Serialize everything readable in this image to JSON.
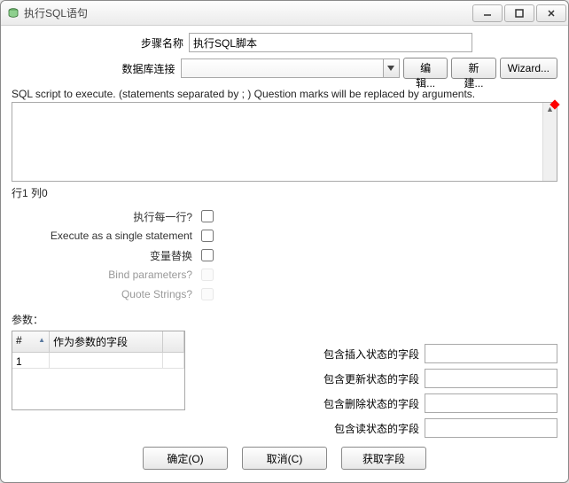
{
  "titlebar": {
    "title": "执行SQL语句"
  },
  "form": {
    "step_name_label": "步骤名称",
    "step_name_value": "执行SQL脚本",
    "db_conn_label": "数据库连接",
    "db_conn_value": "",
    "edit_btn": "编辑...",
    "new_btn": "新建...",
    "wizard_btn": "Wizard...",
    "sql_label": "SQL script to execute. (statements separated by ; ) Question marks will be replaced by arguments.",
    "sql_value": "",
    "position_label": "行1 列0"
  },
  "checks": {
    "each_row": "执行每一行?",
    "single_stmt": "Execute as a single statement",
    "var_sub": "变量替换",
    "bind_params": "Bind parameters?",
    "quote_strings": "Quote Strings?"
  },
  "params": {
    "label": "参数：",
    "header_num": "#",
    "header_field": "作为参数的字段",
    "rows": [
      {
        "num": "1",
        "field": ""
      }
    ]
  },
  "status": {
    "insert": "包含插入状态的字段",
    "update": "包含更新状态的字段",
    "delete": "包含删除状态的字段",
    "read": "包含读状态的字段",
    "insert_val": "",
    "update_val": "",
    "delete_val": "",
    "read_val": ""
  },
  "footer": {
    "ok": "确定(O)",
    "cancel": "取消(C)",
    "get_fields": "获取字段"
  }
}
